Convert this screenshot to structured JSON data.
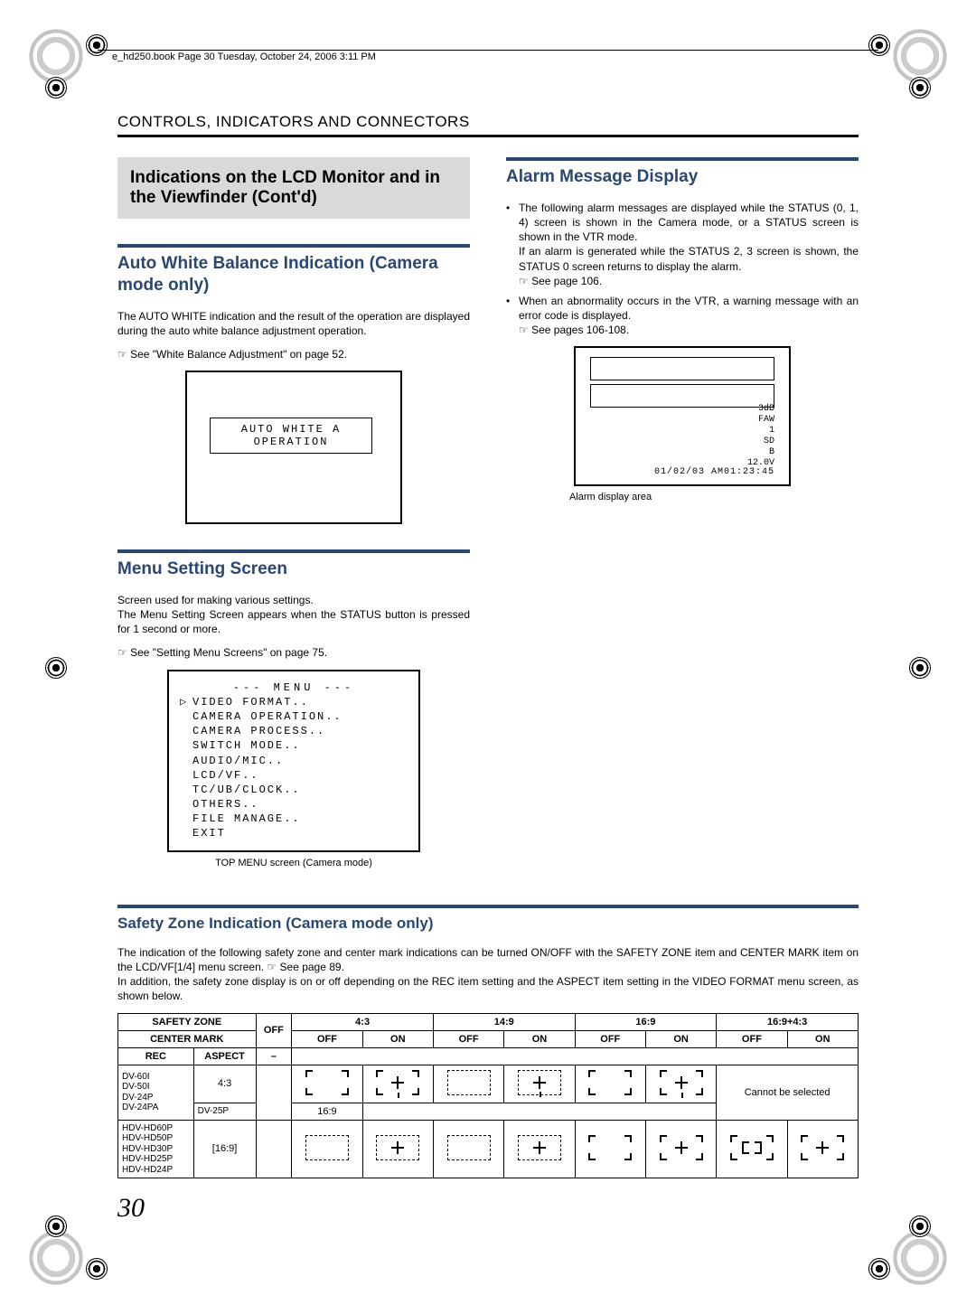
{
  "header_line": "e_hd250.book  Page 30  Tuesday, October 24, 2006  3:11 PM",
  "section_title": "CONTROLS, INDICATORS AND CONNECTORS",
  "contd_box": "Indications on the LCD Monitor and in the Viewfinder (Cont'd)",
  "awb": {
    "heading": "Auto White Balance Indication (Camera mode only)",
    "text": "The AUTO WHITE indication and the result of the operation are displayed during the auto white balance adjustment operation.",
    "ref": "See \"White Balance Adjustment\" on page 52.",
    "lcd_line1": "AUTO WHITE A",
    "lcd_line2": "OPERATION"
  },
  "menu": {
    "heading": "Menu Setting Screen",
    "text1": "Screen used for making various settings.",
    "text2": "The Menu Setting Screen appears when the STATUS button is pressed for 1 second or more.",
    "ref": "See \"Setting Menu Screens\" on page 75.",
    "box_title": "--- MENU ---",
    "items": [
      "VIDEO FORMAT..",
      "CAMERA OPERATION..",
      "CAMERA PROCESS..",
      "SWITCH MODE..",
      "AUDIO/MIC..",
      "LCD/VF..",
      "TC/UB/CLOCK..",
      "OTHERS..",
      "FILE MANAGE..",
      "EXIT"
    ],
    "caption": "TOP MENU screen (Camera mode)"
  },
  "alarm": {
    "heading": "Alarm Message Display",
    "b1a": "The following alarm messages are displayed while the STATUS (0, 1, 4) screen is shown in the Camera mode, or a STATUS screen is shown in the VTR mode.",
    "b1b": "If an alarm is generated while the STATUS 2, 3 screen is shown, the STATUS 0 screen returns to display the alarm.",
    "ref1": "See page 106.",
    "b2": "When an abnormality occurs in the VTR, a warning message with an error code is displayed.",
    "ref2": "See pages 106-108.",
    "status_l1": "3dB",
    "status_l2": "FAW",
    "status_l3": "1",
    "status_l4": "SD",
    "status_l5": "B",
    "status_l6": "12.0V",
    "status_bottom": "01/02/03 AM01:23:45",
    "caption": "Alarm display area"
  },
  "sz": {
    "heading": "Safety Zone Indication (Camera mode only)",
    "text1": "The indication of the following safety zone and center mark indications can be turned ON/OFF with the SAFETY ZONE item and CENTER MARK item on the LCD/VF[1/4] menu screen.",
    "ref": "See page 89.",
    "text2": "In addition, the safety zone display is on or off depending on the REC item setting and the ASPECT item setting in the VIDEO FORMAT menu screen, as shown below.",
    "hdr": {
      "safety_zone": "SAFETY ZONE",
      "off": "OFF",
      "r43": "4:3",
      "r149": "14:9",
      "r169": "16:9",
      "r169p43": "16:9+4:3",
      "center_mark": "CENTER MARK",
      "dash": "–",
      "on": "ON",
      "rec": "REC",
      "aspect": "ASPECT"
    },
    "row1": {
      "rec_list": "DV-60I\nDV-50I\nDV-24P\nDV-24PA",
      "aspect": "4:3",
      "cannot": "Cannot be selected"
    },
    "row2": {
      "rec": "DV-25P",
      "aspect": "16:9"
    },
    "row3": {
      "rec_list": "HDV-HD60P\nHDV-HD50P\nHDV-HD30P\nHDV-HD25P\nHDV-HD24P",
      "aspect": "[16:9]"
    }
  },
  "page_number": "30"
}
